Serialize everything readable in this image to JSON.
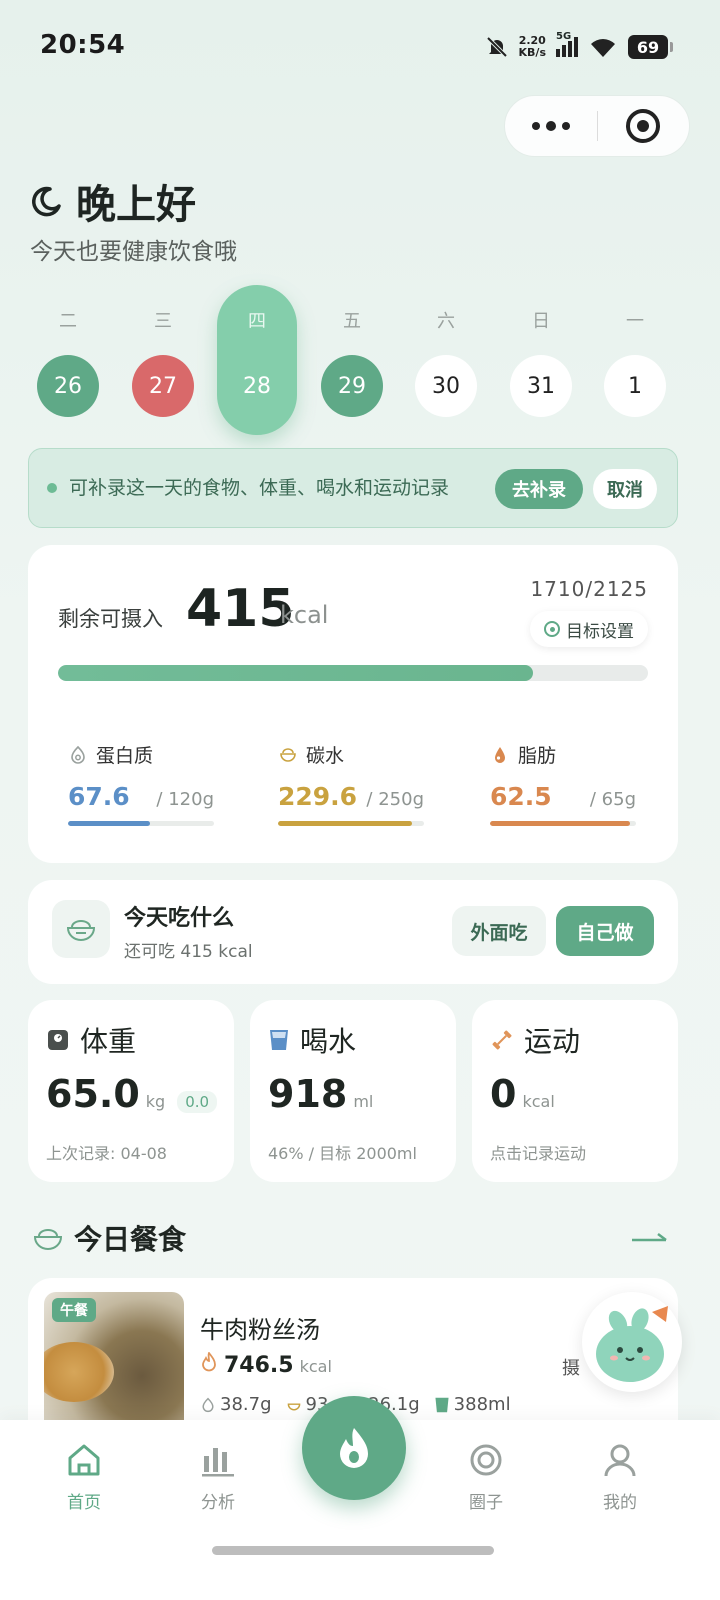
{
  "status": {
    "time": "20:54",
    "net_speed_value": "2.20",
    "net_speed_unit": "KB/s",
    "signal": "5G",
    "battery": "69"
  },
  "greeting": {
    "title": "晚上好",
    "subtitle": "今天也要健康饮食哦"
  },
  "week": {
    "days": [
      {
        "weekday": "二",
        "date": "26",
        "state": "recorded-ok"
      },
      {
        "weekday": "三",
        "date": "27",
        "state": "recorded-over"
      },
      {
        "weekday": "四",
        "date": "28",
        "state": "selected"
      },
      {
        "weekday": "五",
        "date": "29",
        "state": "recorded-ok"
      },
      {
        "weekday": "六",
        "date": "30",
        "state": "empty"
      },
      {
        "weekday": "日",
        "date": "31",
        "state": "empty"
      },
      {
        "weekday": "一",
        "date": "1",
        "state": "empty"
      }
    ]
  },
  "banner": {
    "text": "可补录这一天的食物、体重、喝水和运动记录",
    "backfill_label": "去补录",
    "cancel_label": "取消"
  },
  "calories": {
    "remaining_label": "剩余可摄入",
    "remaining_value": "415",
    "unit": "kcal",
    "ratio": "1710/2125",
    "goal_button": "目标设置",
    "progress": 0.8047
  },
  "macros": [
    {
      "name": "蛋白质",
      "value": "67.6",
      "target": "/ 120g",
      "progress": 0.563,
      "color": "#5b8fc7",
      "icon": "protein-icon"
    },
    {
      "name": "碳水",
      "value": "229.6",
      "target": "/ 250g",
      "progress": 0.918,
      "color": "#c9a23f",
      "icon": "carb-icon"
    },
    {
      "name": "脂肪",
      "value": "62.5",
      "target": "/ 65g",
      "progress": 0.962,
      "color": "#d9884f",
      "icon": "fat-icon"
    }
  ],
  "what_to_eat": {
    "title": "今天吃什么",
    "subtitle": "还可吃 415 kcal",
    "eat_out_label": "外面吃",
    "cook_label": "自己做"
  },
  "stats": {
    "weight": {
      "title": "体重",
      "value": "65.0",
      "unit": "kg",
      "delta": "0.0",
      "foot": "上次记录: 04-08"
    },
    "water": {
      "title": "喝水",
      "value": "918",
      "unit": "ml",
      "foot": "46% / 目标 2000ml"
    },
    "exercise": {
      "title": "运动",
      "value": "0",
      "unit": "kcal",
      "foot": "点击记录运动"
    }
  },
  "meals": {
    "title": "今日餐食",
    "items": [
      {
        "tag": "午餐",
        "name": "牛肉粉丝汤",
        "kcal": "746.5",
        "unit": "kcal",
        "protein": "38.7g",
        "carb": "93.",
        "fat": "26.1g",
        "water": "388ml",
        "extra": "摄"
      }
    ]
  },
  "tabs": [
    {
      "label": "首页",
      "icon": "home-icon",
      "active": true
    },
    {
      "label": "分析",
      "icon": "bar-chart-icon",
      "active": false
    },
    {
      "label": "圈子",
      "icon": "circle-icon",
      "active": false
    },
    {
      "label": "我的",
      "icon": "profile-icon",
      "active": false
    }
  ],
  "colors": {
    "accent": "#5fa987",
    "over": "#d9696a",
    "selected": "#84ceab"
  }
}
